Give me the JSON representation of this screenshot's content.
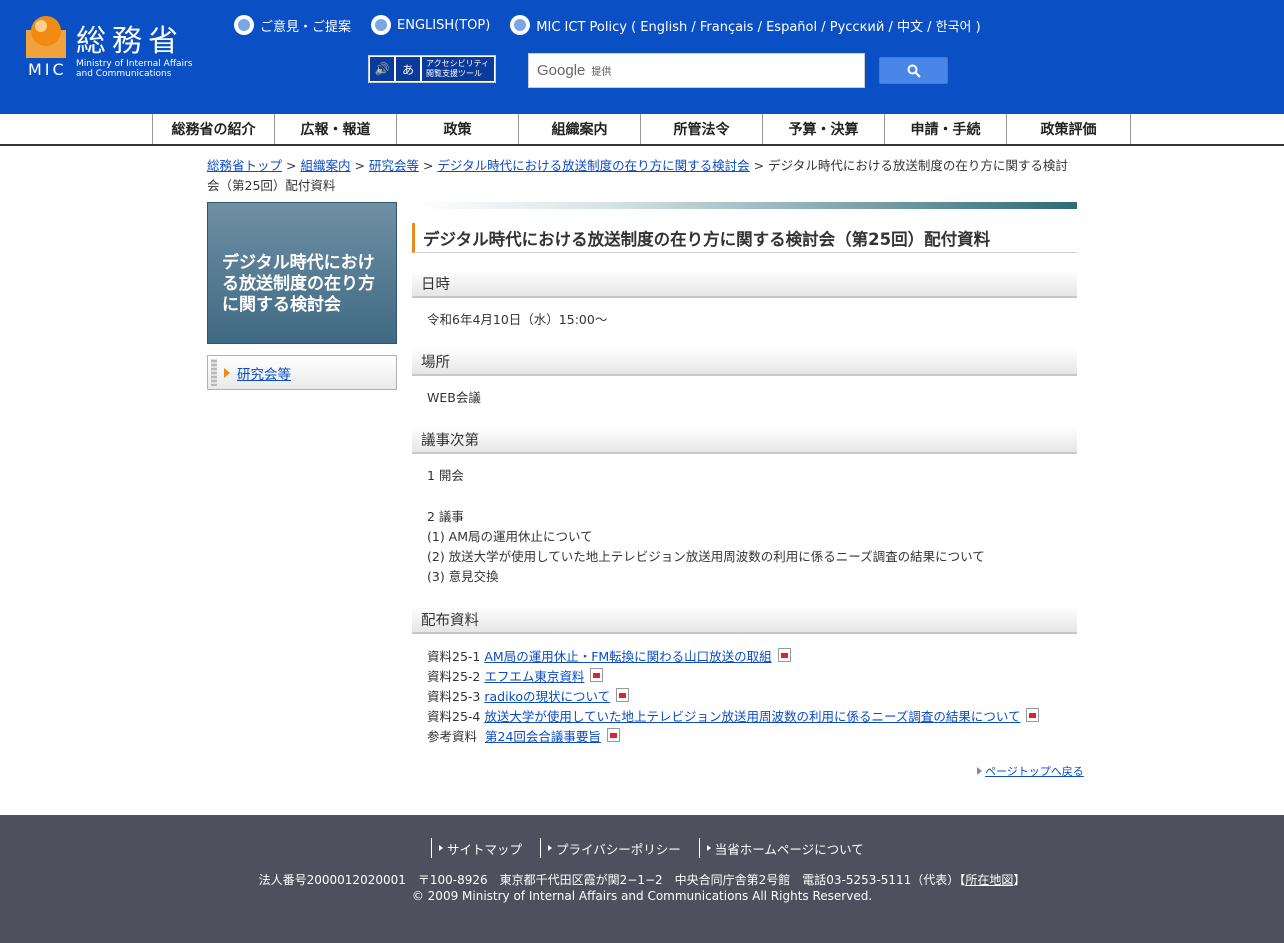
{
  "header": {
    "logo_jp": "総務省",
    "logo_mic": "MIC",
    "logo_en_line1": "Ministry of Internal Affairs",
    "logo_en_line2": "and Communications",
    "toplinks": [
      {
        "label": "ご意見・ご提案"
      },
      {
        "label": "ENGLISH(TOP)"
      },
      {
        "label": "MIC ICT Policy ( English / Français / Español / Русский / 中文 / 한국어 )"
      }
    ],
    "access_tool_line1": "アクセシビリティ",
    "access_tool_line2": "閲覧支援ツール",
    "search_brand": "Google",
    "search_provided": "提供"
  },
  "nav": [
    {
      "label": "総務省の紹介"
    },
    {
      "label": "広報・報道"
    },
    {
      "label": "政策"
    },
    {
      "label": "組織案内"
    },
    {
      "label": "所管法令"
    },
    {
      "label": "予算・決算"
    },
    {
      "label": "申請・手続"
    },
    {
      "label": "政策評価"
    }
  ],
  "breadcrumb": {
    "items": [
      "総務省トップ",
      "組織案内",
      "研究会等",
      "デジタル時代における放送制度の在り方に関する検討会"
    ],
    "separator": ">",
    "current": "デジタル時代における放送制度の在り方に関する検討会（第25回）配付資料"
  },
  "sidebar": {
    "title": "デジタル時代における放送制度の在り方に関する検討会",
    "items": [
      {
        "label": "研究会等"
      }
    ]
  },
  "main": {
    "title": "デジタル時代における放送制度の在り方に関する検討会（第25回）配付資料",
    "sections": {
      "datetime": {
        "heading": "日時",
        "text": "令和6年4月10日（水）15:00〜"
      },
      "place": {
        "heading": "場所",
        "text": "WEB会議"
      },
      "agenda": {
        "heading": "議事次第",
        "open": "1 開会",
        "discussion": "2 議事",
        "items": [
          "(1) AM局の運用休止について",
          "(2) 放送大学が使用していた地上テレビジョン放送用周波数の利用に係るニーズ調査の結果について",
          "(3) 意見交換"
        ]
      },
      "materials": {
        "heading": "配布資料",
        "items": [
          {
            "label": "資料25-1",
            "link": "AM局の運用休止・FM転換に関わる山口放送の取組"
          },
          {
            "label": "資料25-2",
            "link": "エフエム東京資料"
          },
          {
            "label": "資料25-3",
            "link": "radikoの現状について"
          },
          {
            "label": "資料25-4",
            "link": "放送大学が使用していた地上テレビジョン放送用周波数の利用に係るニーズ調査の結果について"
          },
          {
            "label": "参考資料",
            "link": "第24回会合議事要旨"
          }
        ]
      }
    },
    "pagetop": "ページトップへ戻る"
  },
  "footer": {
    "links": [
      {
        "label": "サイトマップ"
      },
      {
        "label": "プライバシーポリシー"
      },
      {
        "label": "当省ホームページについて"
      }
    ],
    "address": "法人番号2000012020001　〒100-8926　東京都千代田区霞が関2−1−2　中央合同庁舎第2号館　電話03-5253-5111（代表）",
    "map_open": "【",
    "map_link": "所在地図",
    "map_close": "】",
    "copyright": "© 2009 Ministry of Internal Affairs and Communications All Rights Reserved."
  },
  "colors": {
    "header_bg": "#0a4fc4",
    "accent_orange": "#e98b1c",
    "footer_bg": "#4f4f5e",
    "link": "#0b4cc4"
  }
}
